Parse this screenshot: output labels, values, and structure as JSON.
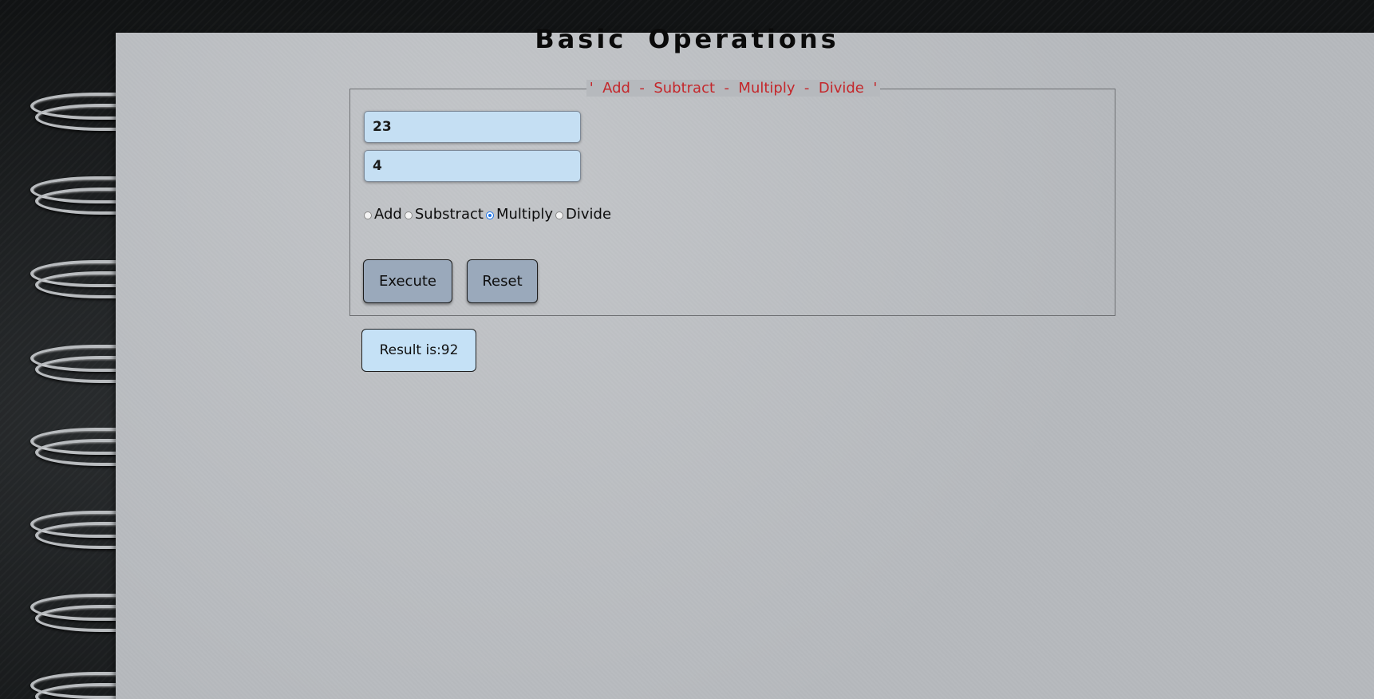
{
  "page": {
    "title": "Basic Operations",
    "legend": "'  Add  -  Subtract  -  Multiply  -  Divide  '"
  },
  "form": {
    "first_value": "23",
    "second_value": "4",
    "operations": [
      {
        "label": "Add",
        "checked": false
      },
      {
        "label": "Substract",
        "checked": false
      },
      {
        "label": "Multiply",
        "checked": true
      },
      {
        "label": "Divide",
        "checked": false
      }
    ],
    "execute_label": "Execute",
    "reset_label": "Reset"
  },
  "result": {
    "text": "Result is:92"
  },
  "colors": {
    "legend": "#c4272b",
    "input_bg": "#c5dff3",
    "button_bg": "#9aa9bb",
    "radio_accent": "#1a73e8"
  }
}
